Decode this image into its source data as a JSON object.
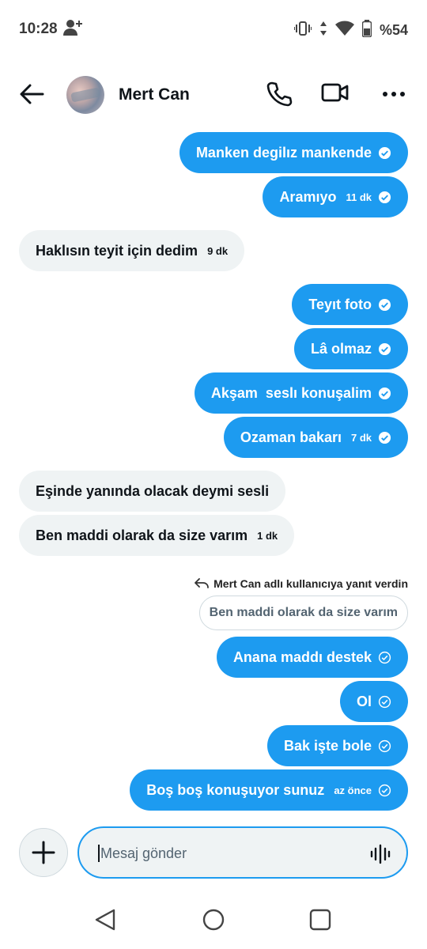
{
  "status_bar": {
    "time": "10:28",
    "battery": "%54"
  },
  "header": {
    "contact_name": "Mert Can"
  },
  "messages": [
    {
      "dir": "out",
      "text": "Manken degilız mankende",
      "time": ""
    },
    {
      "dir": "out",
      "text": "Aramıyo",
      "time": "11 dk"
    },
    {
      "dir": "in",
      "text": "Haklısın teyit için dedim",
      "time": "9 dk"
    },
    {
      "dir": "out",
      "text": "Teyıt foto",
      "time": ""
    },
    {
      "dir": "out",
      "text": "Lâ olmaz",
      "time": ""
    },
    {
      "dir": "out",
      "text": "Akşam  seslı konuşalim",
      "time": ""
    },
    {
      "dir": "out",
      "text": "Ozaman bakarı",
      "time": "7 dk"
    },
    {
      "dir": "in",
      "text": "Eşinde yanında olacak deymi sesli",
      "time": ""
    },
    {
      "dir": "in",
      "text": "Ben maddi olarak da size varım",
      "time": "1 dk"
    }
  ],
  "reply": {
    "note": "Mert Can adlı kullanıcıya yanıt verdin",
    "quoted": "Ben maddi olarak da size varım"
  },
  "messages_after": [
    {
      "dir": "out",
      "text": "Anana maddı destek",
      "time": ""
    },
    {
      "dir": "out",
      "text": "Ol",
      "time": ""
    },
    {
      "dir": "out",
      "text": "Bak işte bole",
      "time": ""
    },
    {
      "dir": "out",
      "text": "Boş boş konuşuyor sunuz",
      "time": "az önce"
    }
  ],
  "composer": {
    "placeholder": "Mesaj gönder"
  },
  "colors": {
    "accent": "#1d9bf0",
    "incoming_bg": "#eff3f4",
    "text": "#0f1419"
  }
}
